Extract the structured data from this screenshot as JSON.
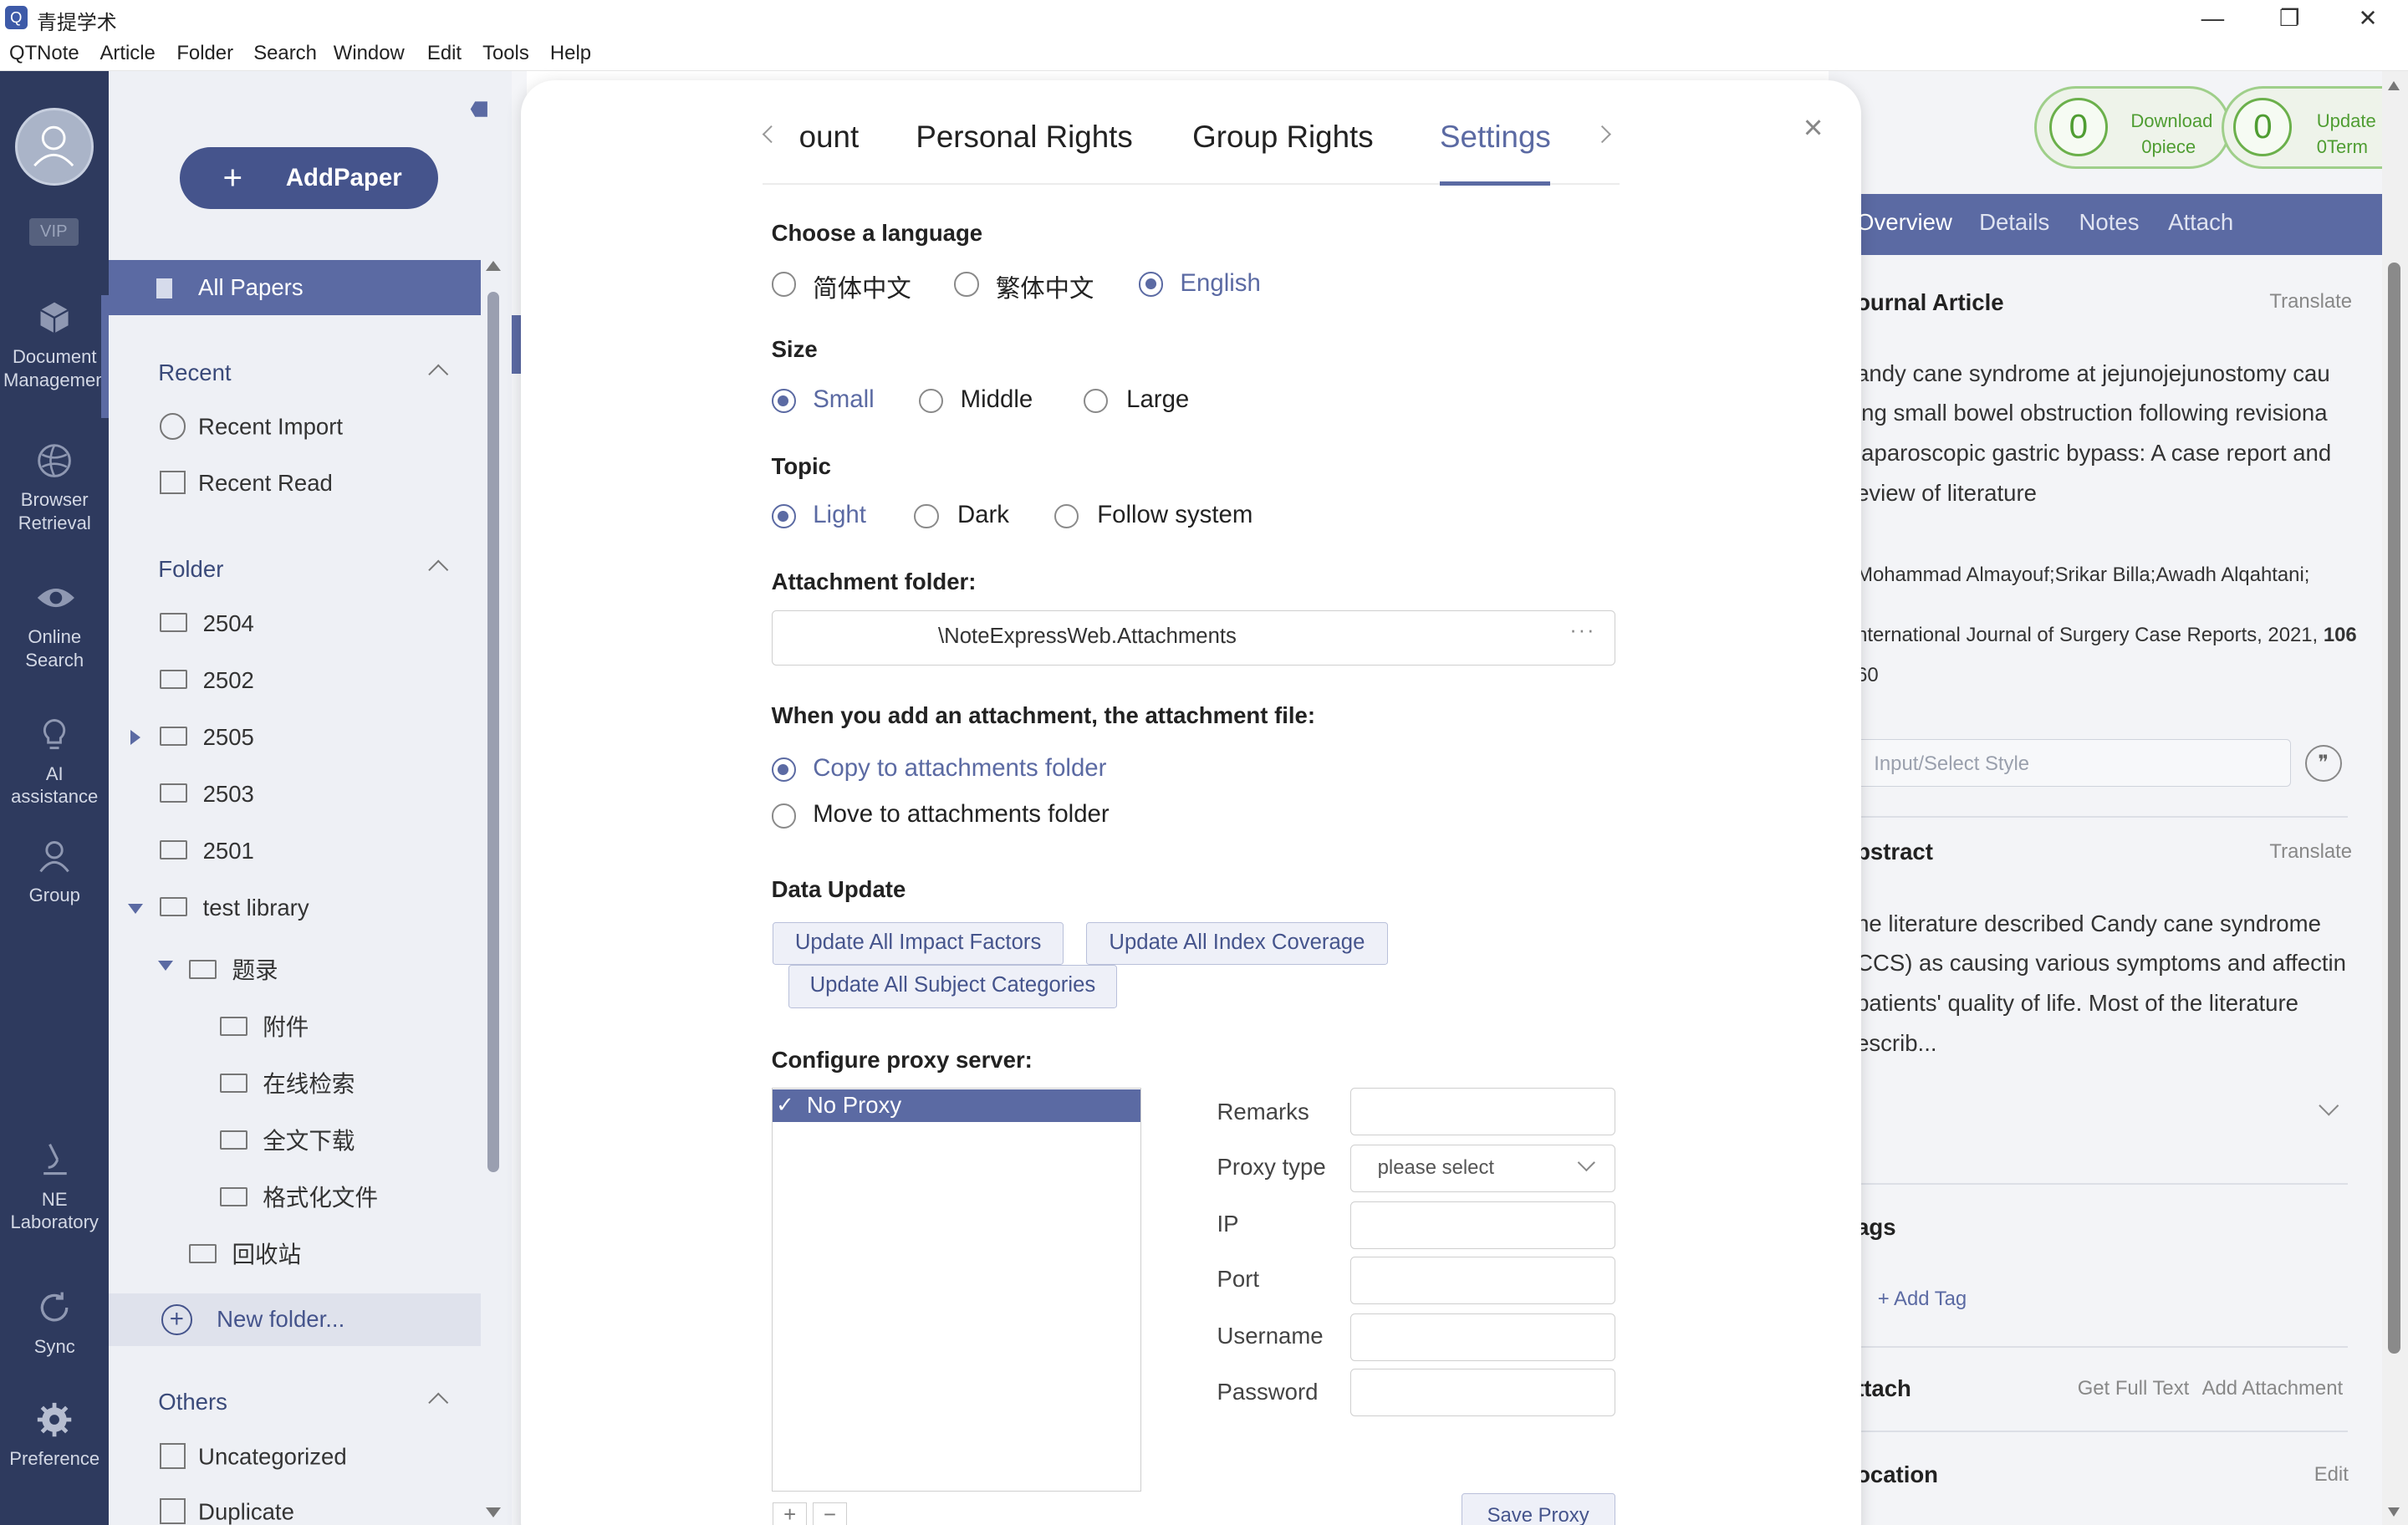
{
  "window": {
    "title": "青提学术",
    "logo": "Q",
    "controls": {
      "minimize": "—",
      "restore": "❐",
      "close": "✕"
    }
  },
  "menu": [
    "QTNote",
    "Article",
    "Folder",
    "Search",
    "Window",
    "Edit",
    "Tools",
    "Help"
  ],
  "rail": {
    "vip": "VIP",
    "items": [
      {
        "label1": "Document",
        "label2": "Managemen",
        "icon": "cube-icon"
      },
      {
        "label1": "Browser",
        "label2": "Retrieval",
        "icon": "browser-icon"
      },
      {
        "label1": "Online",
        "label2": "Search",
        "icon": "eye-icon"
      },
      {
        "label1": "AI assistance",
        "label2": "",
        "icon": "bulb-icon"
      },
      {
        "label1": "Group",
        "label2": "",
        "icon": "group-icon"
      },
      {
        "label1": "NE",
        "label2": "Laboratory",
        "icon": "microscope-icon"
      },
      {
        "label1": "Sync",
        "label2": "",
        "icon": "sync-icon"
      },
      {
        "label1": "Preference",
        "label2": "",
        "icon": "gear-icon"
      }
    ]
  },
  "sidebar": {
    "add_paper": "AddPaper",
    "all_papers": "All Papers",
    "recent_head": "Recent",
    "recent_import": "Recent Import",
    "recent_read": "Recent Read",
    "folder_head": "Folder",
    "folders": [
      "2504",
      "2502",
      "2505",
      "2503",
      "2501",
      "test library",
      "题录",
      "附件",
      "在线检索",
      "全文下载",
      "格式化文件",
      "回收站"
    ],
    "new_folder": "New folder...",
    "others_head": "Others",
    "uncategorized": "Uncategorized",
    "duplicate": "Duplicate"
  },
  "right_panel": {
    "download_count": "0",
    "download_label": "Download",
    "download_unit": "0piece",
    "update_count": "0",
    "update_label": "Update",
    "update_unit": "0Term",
    "tabs": [
      "Overview",
      "Details",
      "Notes",
      "Attach"
    ],
    "type": "ournal Article",
    "translate": "Translate",
    "title_lines": [
      "andy cane syndrome at jejunojejunostomy cau",
      "ing small bowel obstruction following revisiona",
      "laparoscopic gastric bypass: A case report and",
      "eview of literature"
    ],
    "authors": "Mohammad Almayouf;Srikar Billa;Awadh Alqahtani;",
    "journal": "nternational Journal of Surgery Case Reports, 2021,",
    "volume": "106",
    "pages": "60",
    "style_placeholder": "Input/Select Style",
    "abstract_head": "bstract",
    "abstract_lines": [
      "he literature described Candy cane syndrome",
      "CCS) as causing various symptoms and affectin",
      " patients' quality of life. Most of the literature",
      "escrib..."
    ],
    "tags_head": "ags",
    "add_tag": "+ Add Tag",
    "attach_head": "ttach",
    "get_full_text": "Get Full Text",
    "add_attachment": "Add Attachment",
    "location_head": "ocation",
    "edit": "Edit"
  },
  "modal": {
    "tabs": [
      "ount",
      "Personal Rights",
      "Group Rights",
      "Settings"
    ],
    "active_tab": "Settings",
    "language": {
      "title": "Choose a language",
      "options": [
        "简体中文",
        "繁体中文",
        "English"
      ],
      "selected": "English"
    },
    "size": {
      "title": "Size",
      "options": [
        "Small",
        "Middle",
        "Large"
      ],
      "selected": "Small"
    },
    "topic": {
      "title": "Topic",
      "options": [
        "Light",
        "Dark",
        "Follow system"
      ],
      "selected": "Light"
    },
    "attachment_folder": {
      "title": "Attachment folder:",
      "path": "\\NoteExpressWeb.Attachments",
      "browse": "···"
    },
    "attachment_mode": {
      "title": "When you add an attachment, the attachment file:",
      "options": [
        "Copy to attachments folder",
        "Move to attachments folder"
      ],
      "selected": "Copy to attachments folder"
    },
    "data_update": {
      "title": "Data Update",
      "impact": "Update All Impact Factors",
      "index": "Update All Index Coverage",
      "subject": "Update All Subject Categories"
    },
    "proxy": {
      "title": "Configure proxy server:",
      "list": [
        "No Proxy"
      ],
      "check": "✓",
      "labels": {
        "remarks": "Remarks",
        "type": "Proxy type",
        "ip": "IP",
        "port": "Port",
        "username": "Username",
        "password": "Password"
      },
      "type_placeholder": "please select",
      "add": "+",
      "remove": "−",
      "save": "Save Proxy"
    },
    "close": "×"
  },
  "colors": {
    "accent": "#5b6aa3",
    "rail": "#2e3a5e",
    "green": "#6bb04b"
  }
}
